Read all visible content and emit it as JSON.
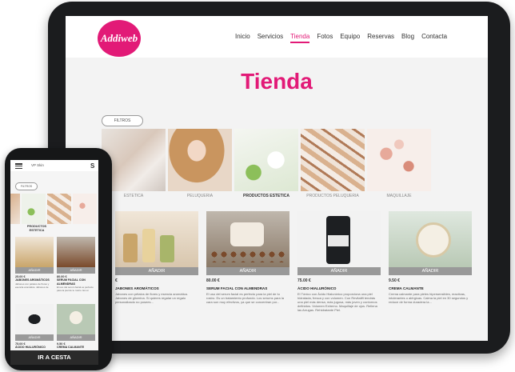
{
  "tablet": {
    "logo_text": "Addiweb",
    "nav": [
      "Inicio",
      "Servicios",
      "Tienda",
      "Fotos",
      "Equipo",
      "Reservas",
      "Blog",
      "Contacta"
    ],
    "active_nav_index": 2,
    "page_title": "Tienda",
    "filter_label": "FILTROS",
    "categories": [
      "ESTETICA",
      "PELUQUERIA",
      "PRODUCTOS ESTETICA",
      "PRODUCTOS PELUQUERIA",
      "MAQUILLAJE"
    ],
    "products": [
      {
        "add": "AÑADIR",
        "price": "€",
        "name": "JABONES AROMÁTICOS",
        "desc": "Jabones con pétalos de flores y esencia aromática. Jabones de glicerina. Si quieres regalar un regalo personalizado no posees..."
      },
      {
        "add": "AÑADIR",
        "price": "80.00 €",
        "name": "SERUM FACIAL CON ALMENDRAS",
        "desc": "El uso del serum facial es perfecto para la piel de tu rostro. Es un tratamiento profundo. Los serums para la cara son muy efectivos, ya que se concentran por..."
      },
      {
        "add": "AÑADIR",
        "price": "75.00 €",
        "name": "ÁCIDO HIALURÓNICO",
        "desc": "El Tónico con Ácido Hialurónico proporciona una piel hidratada, fresca y con volumen. Con Revitalift tendrás una piel más densa, más jugosa, más joven y contornos definidos. Volumen Extremo. Maquillaje de ojos. Rellena las Arrugas. Rehidratante Piel."
      },
      {
        "add": "AÑADIR",
        "price": "9.50 €",
        "name": "CREMA CALMANTE",
        "desc": "Crema calmante para pieles hipersensibles, reactivas, intolerantes o alérgicas. Calma la piel en 30 segundos y reduce de forma duradera la..."
      }
    ]
  },
  "phone": {
    "status_title": "VP Skin",
    "logo_text": "S",
    "filter_label": "FILTROS",
    "category_label": "PRODUCTOS ESTETICA",
    "products": [
      {
        "add": "AÑADIR",
        "price": "25.00 €",
        "name": "JABONES AROMÁTICOS",
        "desc": "Jabones con pétalos de flores y esencia aromática. Jabones de glicerina. Si..."
      },
      {
        "add": "AÑADIR",
        "price": "80.00 €",
        "name": "SERUM FACIAL CON ALMENDRAS",
        "desc": "El uso del serum facial es perfecto para la piel de tu rostro. Es un tratamiento..."
      },
      {
        "add": "AÑADIR",
        "price": "75.00 €",
        "name": "ÁCIDO HIALURÓNICO",
        "desc": ""
      },
      {
        "add": "AÑADIR",
        "price": "9.50 €",
        "name": "CREMA CALMANTE",
        "desc": ""
      }
    ],
    "cart_button": "IR A CESTA"
  },
  "colors": {
    "accent": "#e21a77",
    "device": "#1b1c1e",
    "add_button": "#999999"
  }
}
